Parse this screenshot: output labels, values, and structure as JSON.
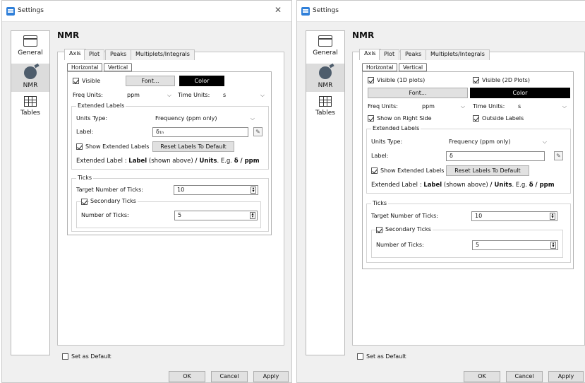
{
  "window_title": "Settings",
  "close_glyph": "✕",
  "section_title": "NMR",
  "sidebar": [
    {
      "label": "General",
      "icon": "general-window-icon"
    },
    {
      "label": "NMR",
      "icon": "nmr-icon"
    },
    {
      "label": "Tables",
      "icon": "tables-icon"
    }
  ],
  "tabs": [
    "Axis",
    "Plot",
    "Peaks",
    "Multiplets/Integrals"
  ],
  "subtabs": [
    "Horizontal",
    "Vertical"
  ],
  "left": {
    "visible_label": "Visible",
    "font_button": "Font...",
    "color_button": "Color",
    "freq_units_label": "Freq Units:",
    "freq_units_value": "ppm",
    "time_units_label": "Time Units:",
    "time_units_value": "s",
    "extended_labels_title": "Extended Labels",
    "units_type_label": "Units Type:",
    "units_type_value": "Frequency (ppm only)",
    "label_label": "Label:",
    "label_value": "δ₁ₕ",
    "show_extended_label": "Show Extended Labels",
    "reset_button": "Reset Labels To Default",
    "ext_prefix": "Extended Label : ",
    "ext_label": "Label",
    "ext_mid": " (shown above) ",
    "ext_units": "/ Units",
    "ext_eg": ". E.g. ",
    "ext_example": "δ / ppm",
    "ticks_title": "Ticks",
    "target_ticks_label": "Target Number of Ticks:",
    "target_ticks_value": "10",
    "secondary_ticks_label": "Secondary Ticks",
    "number_ticks_label": "Number of Ticks:",
    "number_ticks_value": "5"
  },
  "right": {
    "visible_1d_label": "Visible (1D plots)",
    "visible_2d_label": "Visible (2D Plots)",
    "font_button": "Font...",
    "color_button": "Color",
    "freq_units_label": "Freq Units:",
    "freq_units_value": "ppm",
    "time_units_label": "Time Units:",
    "time_units_value": "s",
    "show_right_label": "Show on Right Side",
    "outside_labels_label": "Outside Labels",
    "extended_labels_title": "Extended Labels",
    "units_type_label": "Units Type:",
    "units_type_value": "Frequency (ppm only)",
    "label_label": "Label:",
    "label_value": "δ",
    "show_extended_label": "Show Extended Labels",
    "reset_button": "Reset Labels To Default",
    "ext_prefix": "Extended Label : ",
    "ext_label": "Label",
    "ext_mid": " (shown above) ",
    "ext_units": "/ Units",
    "ext_eg": ". E.g. ",
    "ext_example": "δ / ppm",
    "ticks_title": "Ticks",
    "target_ticks_label": "Target Number of Ticks:",
    "target_ticks_value": "10",
    "secondary_ticks_label": "Secondary Ticks",
    "number_ticks_label": "Number of Ticks:",
    "number_ticks_value": "5"
  },
  "set_default_label": "Set as Default",
  "footer": {
    "ok": "OK",
    "cancel": "Cancel",
    "apply": "Apply"
  },
  "colors": {
    "title_icon": "#2f7fd9",
    "color_button": "#000000",
    "default_button_border": "#2b7bd8"
  }
}
